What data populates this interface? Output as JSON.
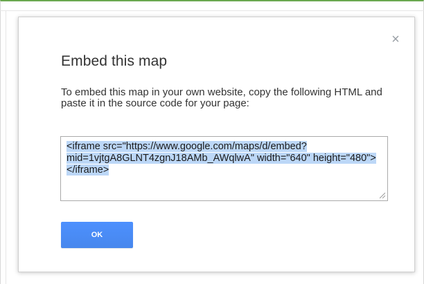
{
  "dialog": {
    "title": "Embed this map",
    "close_glyph": "×",
    "description": "To embed this map in your own website, copy the following HTML and paste it in the source code for your page:",
    "embed_code": "<iframe src=\"https://www.google.com/maps/d/embed?mid=1vjtgA8GLNT4zgnJ18AMb_AWqlwA\" width=\"640\" height=\"480\"></iframe>",
    "ok_label": "OK"
  },
  "colors": {
    "accent": "#4d90fe",
    "selection": "#bcd7f7",
    "frame_top": "#6aa84f"
  },
  "icons": {
    "close": "close-icon",
    "resize": "resize-grip-icon"
  }
}
